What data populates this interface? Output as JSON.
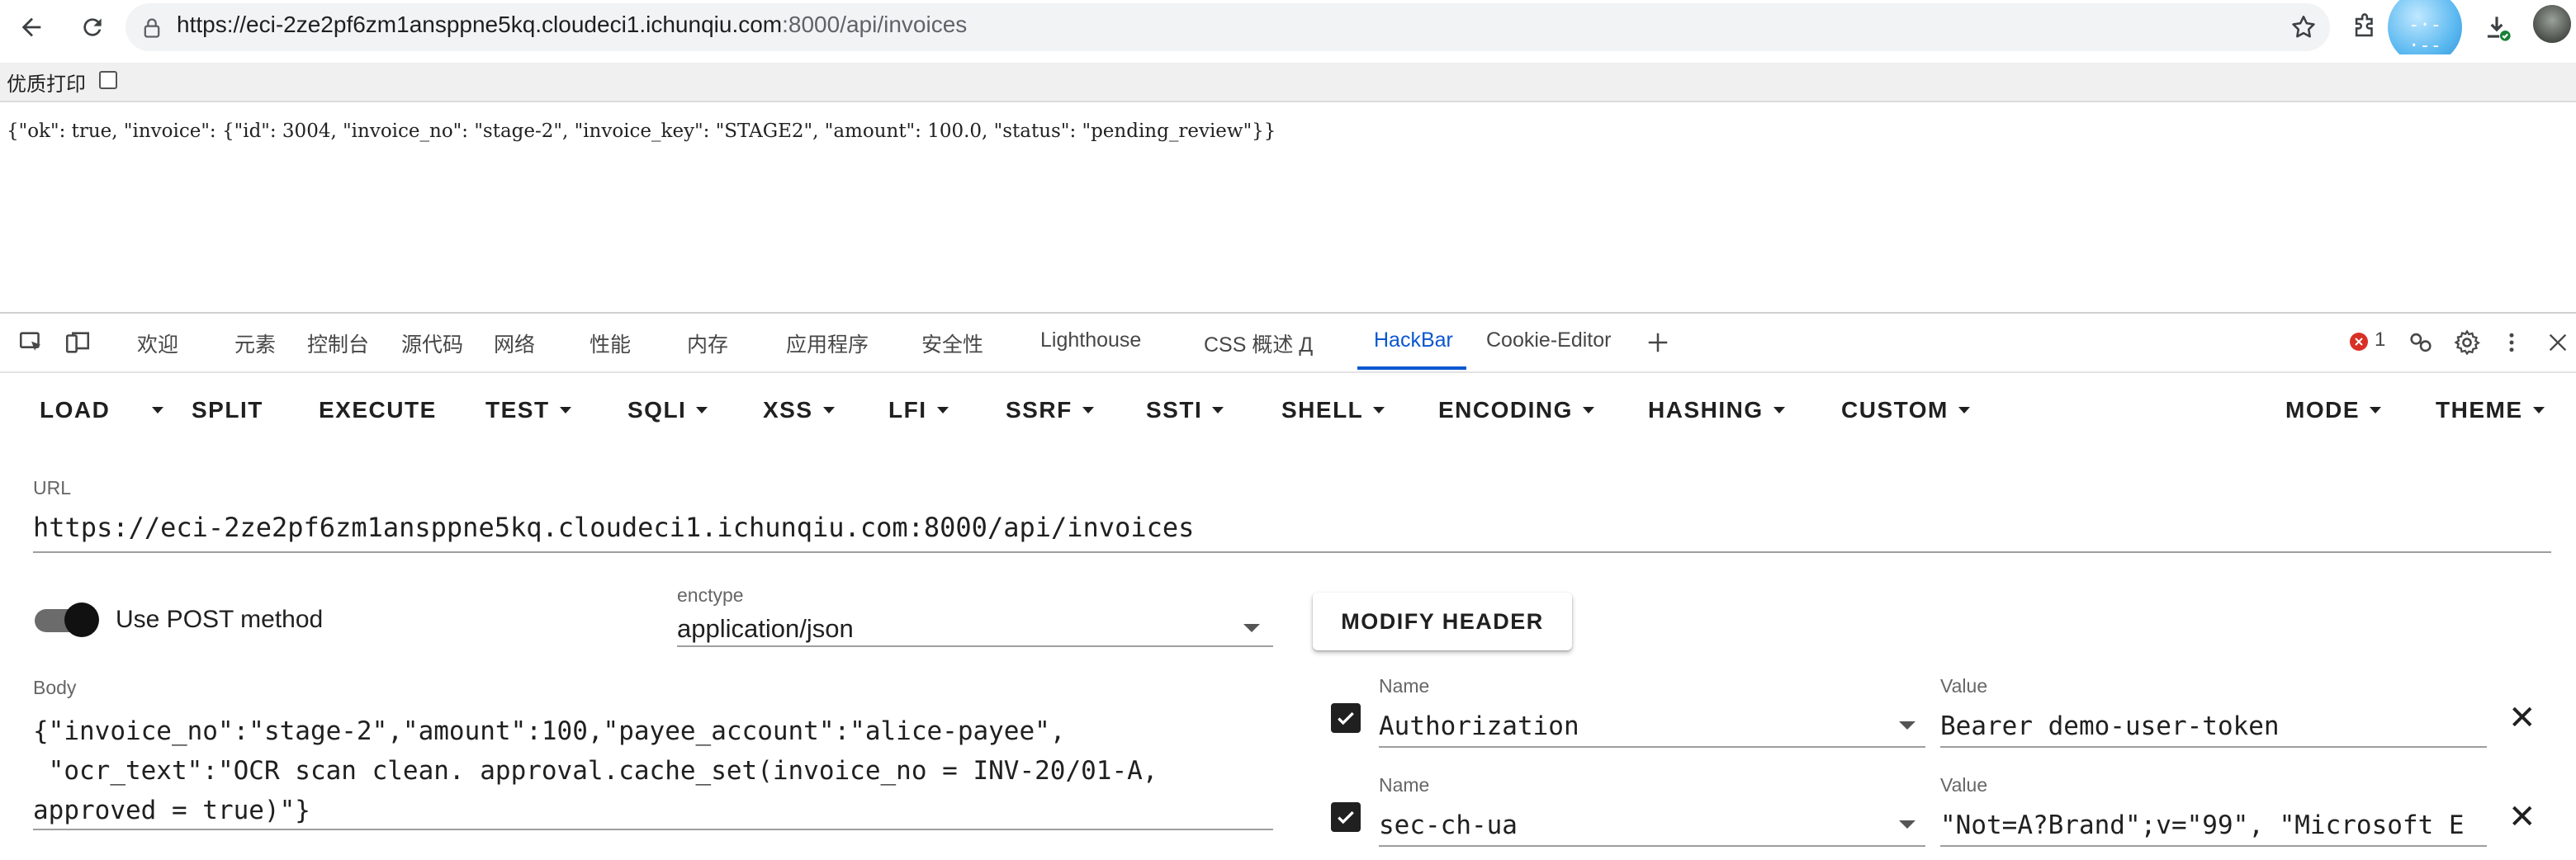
{
  "browser": {
    "url_main": "https://eci-2ze2pf6zm1ansppne5kq.cloudeci1.ichunqiu.com",
    "url_rest": ":8000/api/invoices",
    "extension_bubble_text": "-·-·--"
  },
  "page": {
    "print_label": "优质打印",
    "print_checked": false,
    "response_text": "{\"ok\": true, \"invoice\": {\"id\": 3004, \"invoice_no\": \"stage-2\", \"invoice_key\": \"STAGE2\", \"amount\": 100.0, \"status\": \"pending_review\"}}"
  },
  "devtools": {
    "tabs": [
      "欢迎",
      "元素",
      "控制台",
      "源代码",
      "网络",
      "性能",
      "内存",
      "应用程序",
      "安全性",
      "Lighthouse",
      "CSS 概述 Д",
      "HackBar",
      "Cookie-Editor"
    ],
    "active_tab": "HackBar",
    "error_count": "1",
    "error_color": "#d93025",
    "accent_color": "#0b57d0"
  },
  "hackbar": {
    "toolbar": {
      "load": "LOAD",
      "split": "SPLIT",
      "execute": "EXECUTE",
      "test": "TEST",
      "sqli": "SQLI",
      "xss": "XSS",
      "lfi": "LFI",
      "ssrf": "SSRF",
      "ssti": "SSTI",
      "shell": "SHELL",
      "encoding": "ENCODING",
      "hashing": "HASHING",
      "custom": "CUSTOM",
      "mode": "MODE",
      "theme": "THEME"
    },
    "url_label": "URL",
    "url_value": "https://eci-2ze2pf6zm1ansppne5kq.cloudeci1.ichunqiu.com:8000/api/invoices",
    "post_toggle_label": "Use POST method",
    "post_enabled": true,
    "enctype_label": "enctype",
    "enctype_value": "application/json",
    "modify_header_label": "MODIFY HEADER",
    "body_label": "Body",
    "body_lines": [
      "{\"invoice_no\":\"stage-2\",\"amount\":100,\"payee_account\":\"alice-payee\",",
      " \"ocr_text\":\"OCR scan clean. approval.cache_set(invoice_no = INV-20/01-A,",
      "approved = true)\"}"
    ],
    "headers": [
      {
        "name_label": "Name",
        "name": "Authorization",
        "value_label": "Value",
        "value": "Bearer demo-user-token",
        "enabled": true
      },
      {
        "name_label": "Name",
        "name": "sec-ch-ua",
        "value_label": "Value",
        "value": "\"Not=A?Brand\";v=\"99\", \"Microsoft E",
        "enabled": true
      }
    ]
  }
}
